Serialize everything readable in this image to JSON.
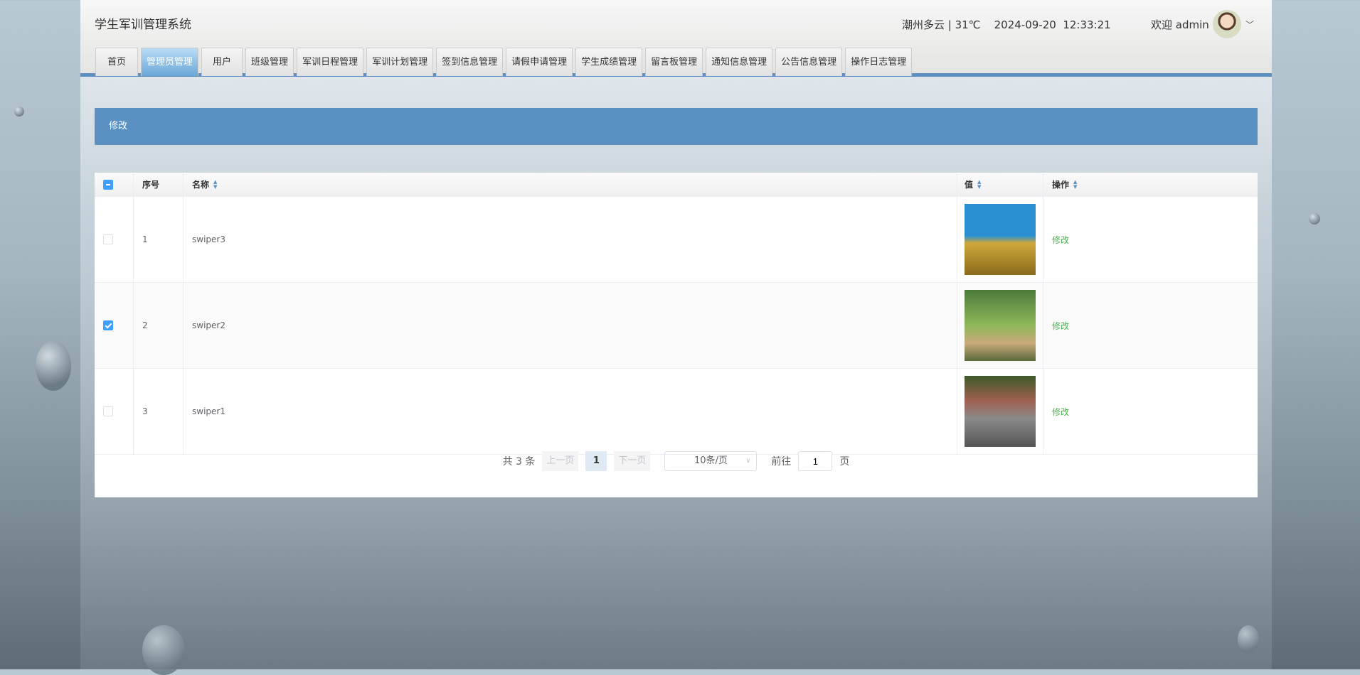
{
  "header": {
    "title": "学生军训管理系统",
    "weather": "潮州多云 | 31℃",
    "datetime": "2024-09-20  12:33:21",
    "welcome": "欢迎 admin"
  },
  "tabs": [
    {
      "label": "首页"
    },
    {
      "label": "管理员管理",
      "active": true
    },
    {
      "label": "用户"
    },
    {
      "label": "班级管理"
    },
    {
      "label": "军训日程管理"
    },
    {
      "label": "军训计划管理"
    },
    {
      "label": "签到信息管理"
    },
    {
      "label": "请假申请管理"
    },
    {
      "label": "学生成绩管理"
    },
    {
      "label": "留言板管理"
    },
    {
      "label": "通知信息管理"
    },
    {
      "label": "公告信息管理"
    },
    {
      "label": "操作日志管理"
    }
  ],
  "action_bar": {
    "label": "修改"
  },
  "table": {
    "columns": [
      "序号",
      "名称",
      "值",
      "操作"
    ],
    "rows": [
      {
        "index": "1",
        "name": "swiper3",
        "action": "修改",
        "checked": false
      },
      {
        "index": "2",
        "name": "swiper2",
        "action": "修改",
        "checked": true
      },
      {
        "index": "3",
        "name": "swiper1",
        "action": "修改",
        "checked": false
      }
    ]
  },
  "pagination": {
    "total": "共 3 条",
    "prev": "上一页",
    "current": "1",
    "next": "下一页",
    "page_size": "10条/页",
    "goto": "前往",
    "goto_value": "1",
    "page_unit": "页"
  }
}
